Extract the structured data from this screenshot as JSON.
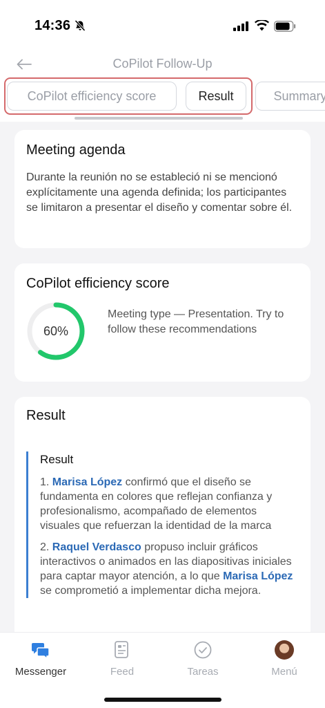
{
  "status_bar": {
    "time": "14:36"
  },
  "header": {
    "title": "CoPilot Follow-Up",
    "tabs": [
      {
        "label": "CoPilot efficiency score"
      },
      {
        "label": "Result"
      },
      {
        "label": "Summary"
      }
    ]
  },
  "agenda": {
    "heading": "Meeting agenda",
    "text": "Durante la reunión no se estableció ni se mencionó explícitamente una agenda definida; los participantes se limitaron a presentar el diseño y comentar sobre él."
  },
  "efficiency": {
    "heading": "CoPilot efficiency score",
    "score_label": "60%",
    "score_fraction": 0.6,
    "description": "Meeting type — Presentation. Try to follow these recommendations",
    "colors": {
      "progress": "#22c76b",
      "track": "#eeeeef"
    }
  },
  "result": {
    "heading": "Result",
    "subheading": "Result",
    "items": [
      {
        "number": "1.",
        "person": "Marisa López",
        "text": "confirmó que el diseño se fundamenta en colores que reflejan confianza y profesionalismo, acompañado de elementos visuales que refuerzan la identidad de la marca"
      },
      {
        "number": "2.",
        "person": "Raquel Verdasco",
        "text": "propuso incluir gráficos interactivos o animados en las diapositivas iniciales para captar mayor atención, a lo que",
        "person2": "Marisa López",
        "text2": "se comprometió a implementar dicha mejora."
      }
    ]
  },
  "bottom_nav": {
    "items": [
      {
        "label": "Messenger",
        "icon": "messenger-icon",
        "active": true
      },
      {
        "label": "Feed",
        "icon": "feed-icon"
      },
      {
        "label": "Tareas",
        "icon": "tasks-icon"
      },
      {
        "label": "Menú",
        "icon": "avatar"
      }
    ]
  },
  "colors": {
    "accent": "#2f7fe0",
    "highlight_border": "#d4696b",
    "link": "#2b69b5"
  }
}
